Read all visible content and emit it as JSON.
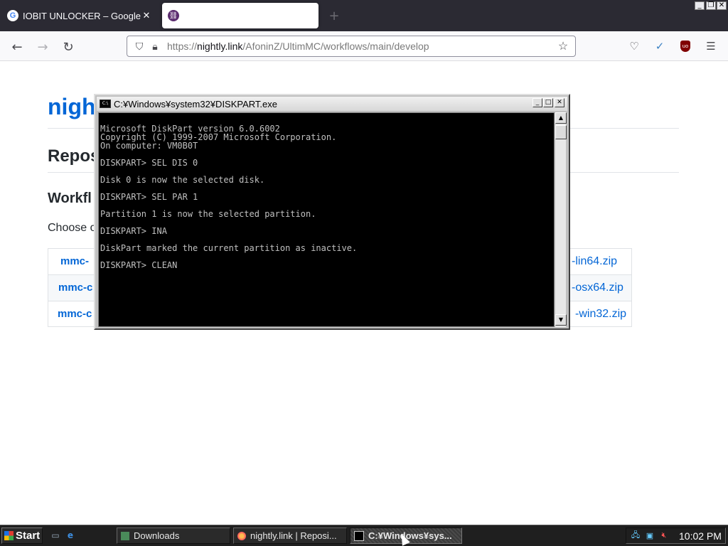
{
  "browser": {
    "tabs": [
      {
        "label": "IOBIT UNLOCKER – Google S",
        "favicon": "google-g-icon",
        "active": false
      },
      {
        "label": "",
        "favicon": "nightly-link-icon",
        "active": true
      }
    ],
    "new_tab": "+",
    "url": {
      "prefix": "https://",
      "host": "nightly.link",
      "path": "/AfoninZ/UltimMC/workflows/main/develop"
    }
  },
  "page": {
    "title": "nigh",
    "section_heading": "Repos",
    "sub_heading": "Workfl",
    "instruction": "Choose o",
    "artifacts": [
      {
        "left": "mmc-",
        "right": "-lin64.zip"
      },
      {
        "left": "mmc-c",
        "right": "-osx64.zip"
      },
      {
        "left": "mmc-c",
        "right": "-win32.zip"
      }
    ]
  },
  "console": {
    "title": "C:¥Windows¥system32¥DISKPART.exe",
    "lines": [
      "Microsoft DiskPart version 6.0.6002",
      "Copyright (C) 1999-2007 Microsoft Corporation.",
      "On computer: VM0B0T",
      "",
      "DISKPART> SEL DIS 0",
      "",
      "Disk 0 is now the selected disk.",
      "",
      "DISKPART> SEL PAR 1",
      "",
      "Partition 1 is now the selected partition.",
      "",
      "DISKPART> INA",
      "",
      "DiskPart marked the current partition as inactive.",
      "",
      "DISKPART> CLEAN"
    ]
  },
  "taskbar": {
    "start_label": "Start",
    "tasks": [
      {
        "label": "Downloads",
        "icon": "folder-icon",
        "active": false
      },
      {
        "label": "nightly.link | Reposi...",
        "icon": "firefox-icon",
        "active": false
      },
      {
        "label": "C:¥Windows¥sys...",
        "icon": "console-icon",
        "active": true
      }
    ],
    "clock": "10:02 PM"
  }
}
